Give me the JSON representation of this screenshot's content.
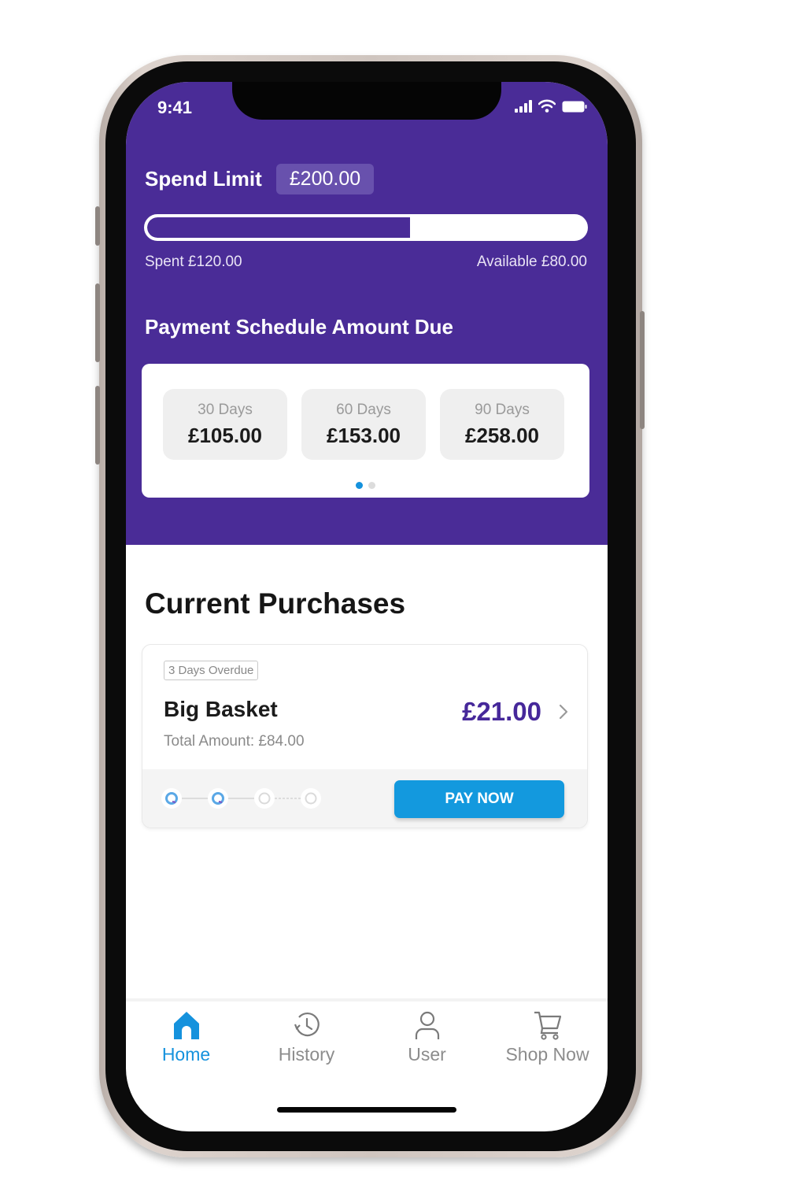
{
  "status_bar": {
    "time": "9:41"
  },
  "spend_limit": {
    "label": "Spend Limit",
    "amount": "£200.00",
    "spent_label": "Spent £120.00",
    "available_label": "Available £80.00",
    "progress_fraction": 0.6
  },
  "schedule": {
    "title": "Payment Schedule Amount Due",
    "items": [
      {
        "days": "30 Days",
        "amount": "£105.00"
      },
      {
        "days": "60 Days",
        "amount": "£153.00"
      },
      {
        "days": "90 Days",
        "amount": "£258.00"
      }
    ],
    "pages": 2,
    "active_page": 1
  },
  "purchases": {
    "title": "Current Purchases",
    "items": [
      {
        "tag": "3 Days Overdue",
        "merchant": "Big Basket",
        "total": "Total Amount: £84.00",
        "due": "£21.00",
        "installments_total": 4,
        "installments_paid": 2,
        "pay_label": "PAY NOW"
      }
    ]
  },
  "tabbar": {
    "items": [
      {
        "label": "Home",
        "icon": "home-icon",
        "active": true
      },
      {
        "label": "History",
        "icon": "history-icon",
        "active": false
      },
      {
        "label": "User",
        "icon": "user-icon",
        "active": false
      },
      {
        "label": "Shop Now",
        "icon": "cart-icon",
        "active": false
      }
    ]
  },
  "colors": {
    "brand_purple": "#4a2c97",
    "accent_blue": "#1399de",
    "amount_purple": "#46289a"
  }
}
